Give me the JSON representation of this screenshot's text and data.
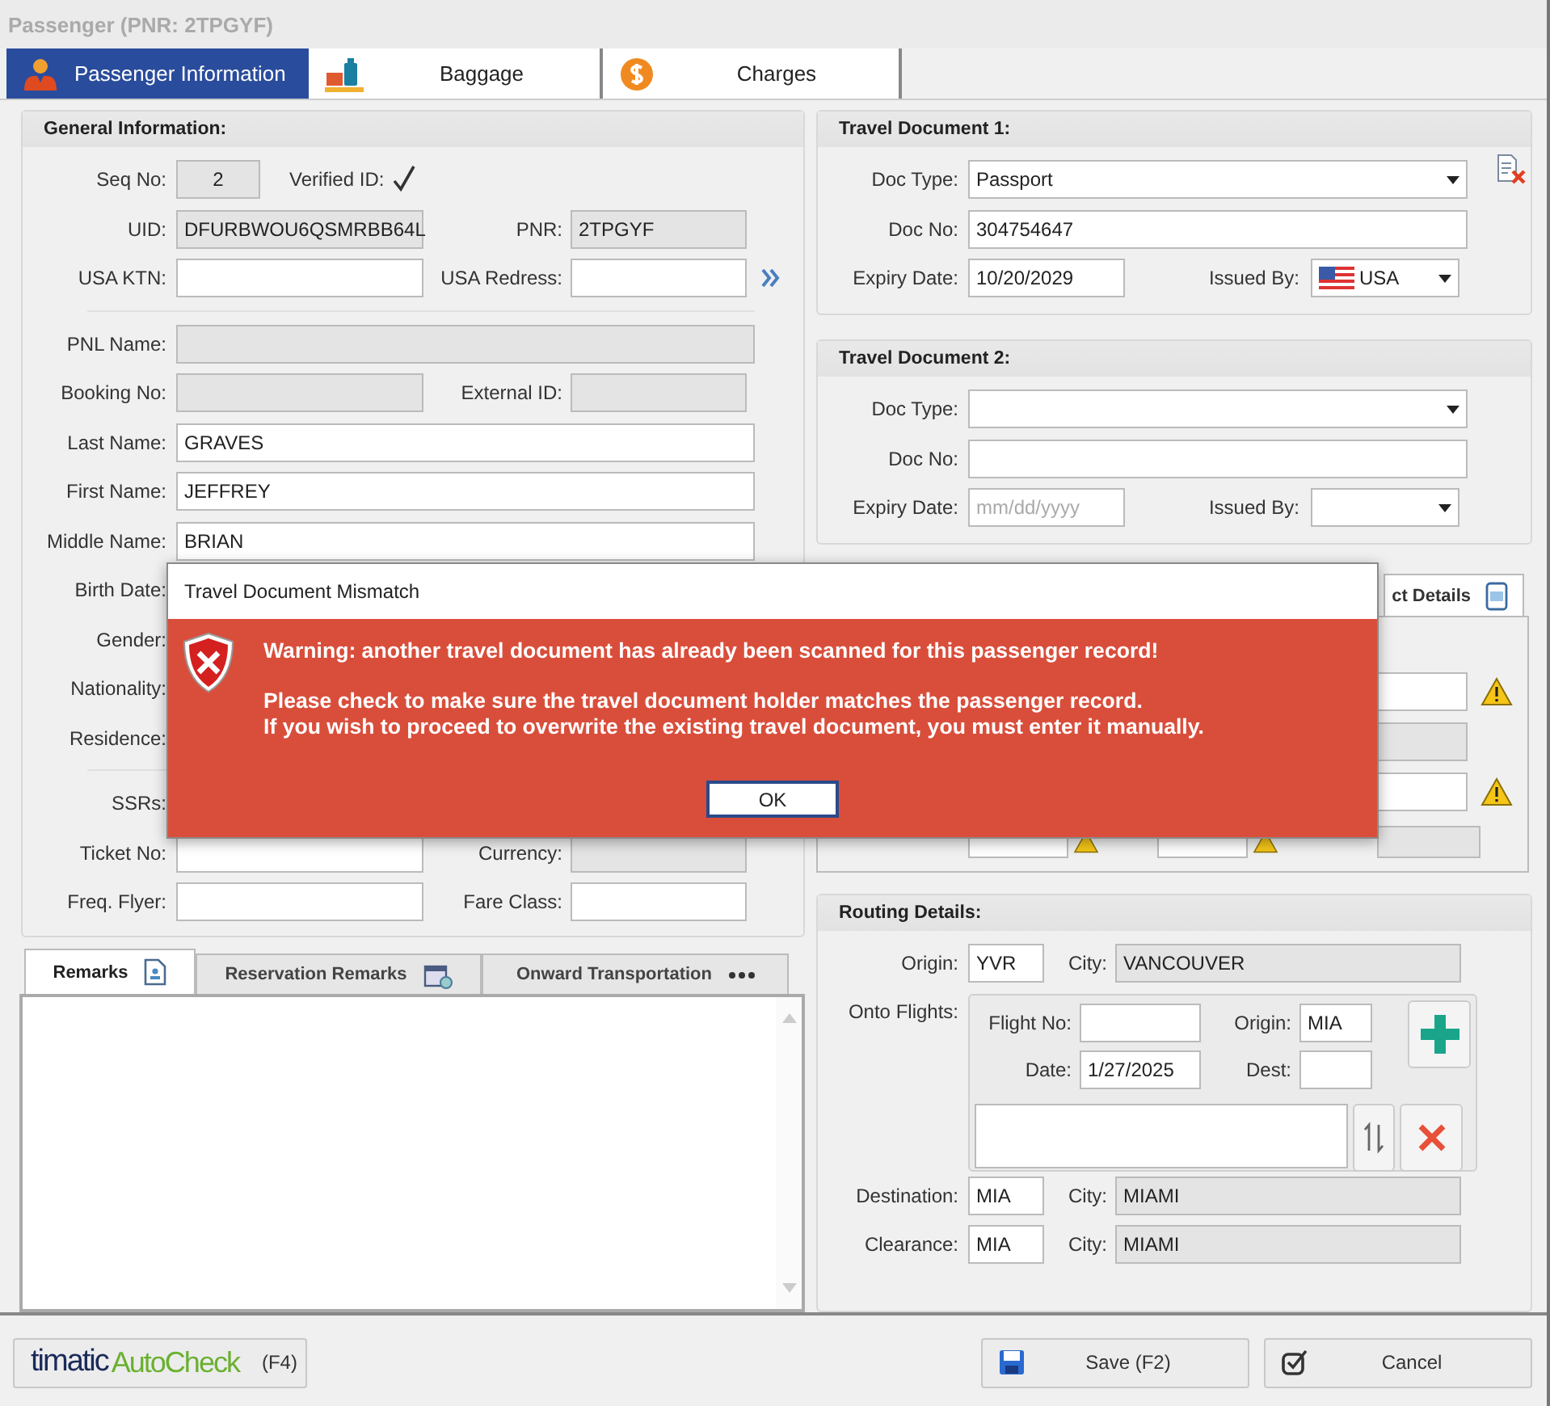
{
  "window": {
    "title": "Passenger (PNR: 2TPGYF)"
  },
  "tabs": [
    {
      "label": "Passenger Information",
      "selected": true
    },
    {
      "label": "Baggage",
      "selected": false
    },
    {
      "label": "Charges",
      "selected": false
    }
  ],
  "general": {
    "title": "General Information:",
    "groups": [
      [
        {
          "fields": [
            {
              "kind": "short",
              "label": "Seq No:",
              "value": "2",
              "readonly": true
            },
            {
              "kind": "check",
              "label": "Verified ID:",
              "checked": true
            }
          ]
        },
        {
          "fields": [
            {
              "kind": "text",
              "label": "UID:",
              "value": "DFURBWOU6QSMRBB64L",
              "readonly": true
            },
            {
              "kind": "text",
              "label": "PNR:",
              "value": "2TPGYF",
              "readonly": true
            }
          ]
        },
        {
          "fields": [
            {
              "kind": "text",
              "label": "USA KTN:",
              "readonly": false
            },
            {
              "kind": "text",
              "label": "USA Redress:",
              "readonly": false
            }
          ],
          "more": true
        }
      ],
      [
        {
          "fields": [
            {
              "kind": "text",
              "label": "PNL Name:",
              "readonly": true
            }
          ]
        },
        {
          "fields": [
            {
              "kind": "text",
              "label": "Booking No:",
              "readonly": true
            },
            {
              "kind": "text",
              "label": "External ID:",
              "readonly": true
            }
          ]
        },
        {
          "fields": [
            {
              "kind": "text",
              "label": "Last Name:",
              "value": "GRAVES",
              "readonly": false
            }
          ]
        },
        {
          "fields": [
            {
              "kind": "text",
              "label": "First Name:",
              "value": "JEFFREY",
              "readonly": false
            }
          ]
        },
        {
          "fields": [
            {
              "kind": "text",
              "label": "Middle Name:",
              "value": "BRIAN",
              "readonly": false
            }
          ]
        },
        {
          "fields": [
            {
              "kind": "text",
              "label": "Birth Date:"
            }
          ]
        },
        {
          "fields": [
            {
              "kind": "text",
              "label": "Gender:"
            }
          ]
        },
        {
          "fields": [
            {
              "kind": "text",
              "label": "Nationality:"
            }
          ]
        },
        {
          "fields": [
            {
              "kind": "text",
              "label": "Residence:"
            }
          ]
        }
      ],
      [
        {
          "fields": [
            {
              "kind": "text",
              "label": "SSRs:"
            }
          ]
        },
        {
          "fields": [
            {
              "kind": "text",
              "label": "Ticket No:",
              "readonly": false
            },
            {
              "kind": "text",
              "label": "Currency:",
              "readonly": true
            }
          ]
        },
        {
          "fields": [
            {
              "kind": "text",
              "label": "Freq. Flyer:",
              "readonly": false
            },
            {
              "kind": "text",
              "label": "Fare Class:",
              "readonly": false
            }
          ]
        }
      ]
    ]
  },
  "remark_tabs": [
    {
      "label": "Remarks",
      "selected": true
    },
    {
      "label": "Reservation Remarks",
      "selected": false
    },
    {
      "label": "Onward Transportation",
      "selected": false
    }
  ],
  "travel_documents": [
    {
      "title": "Travel Document 1:",
      "removable": true,
      "doc_type": {
        "label": "Doc Type:",
        "value": "Passport"
      },
      "doc_no": {
        "label": "Doc No:",
        "value": "304754647"
      },
      "expiry": {
        "label": "Expiry Date:",
        "value": "10/20/2029"
      },
      "issued_by": {
        "label": "Issued By:",
        "value": "USA"
      }
    },
    {
      "title": "Travel Document 2:",
      "removable": false,
      "doc_type": {
        "label": "Doc Type:"
      },
      "doc_no": {
        "label": "Doc No:"
      },
      "expiry": {
        "label": "Expiry Date:",
        "placeholder": "mm/dd/yyyy"
      },
      "issued_by": {
        "label": "Issued By:"
      }
    }
  ],
  "contact": {
    "tab_label": "ct Details"
  },
  "routing": {
    "title": "Routing Details:",
    "origin": {
      "label": "Origin:",
      "value": "YVR"
    },
    "origin_city": {
      "label": "City:",
      "value": "VANCOUVER"
    },
    "onto_label": "Onto Flights:",
    "flight_no": {
      "label": "Flight No:"
    },
    "flight_origin": {
      "label": "Origin:",
      "value": "MIA"
    },
    "date": {
      "label": "Date:",
      "value": "1/27/2025"
    },
    "dest": {
      "label": "Dest:"
    },
    "destination": {
      "label": "Destination:",
      "value": "MIA"
    },
    "destination_city": {
      "label": "City:",
      "value": "MIAMI"
    },
    "clearance": {
      "label": "Clearance:",
      "value": "MIA"
    },
    "clearance_city": {
      "label": "City:",
      "value": "MIAMI"
    }
  },
  "footer": {
    "brand": "timatic",
    "product": "AutoCheck",
    "key": "(F4)",
    "save": "Save (F2)",
    "cancel": "Cancel"
  },
  "dialog": {
    "title": "Travel Document Mismatch",
    "warning": "Warning: another travel document has already been scanned for this passenger record!",
    "lines": [
      "Please check to make sure the travel document holder matches the passenger record.",
      "If you wish to proceed to overwrite the existing travel document, you must enter it manually."
    ],
    "ok": "OK"
  }
}
